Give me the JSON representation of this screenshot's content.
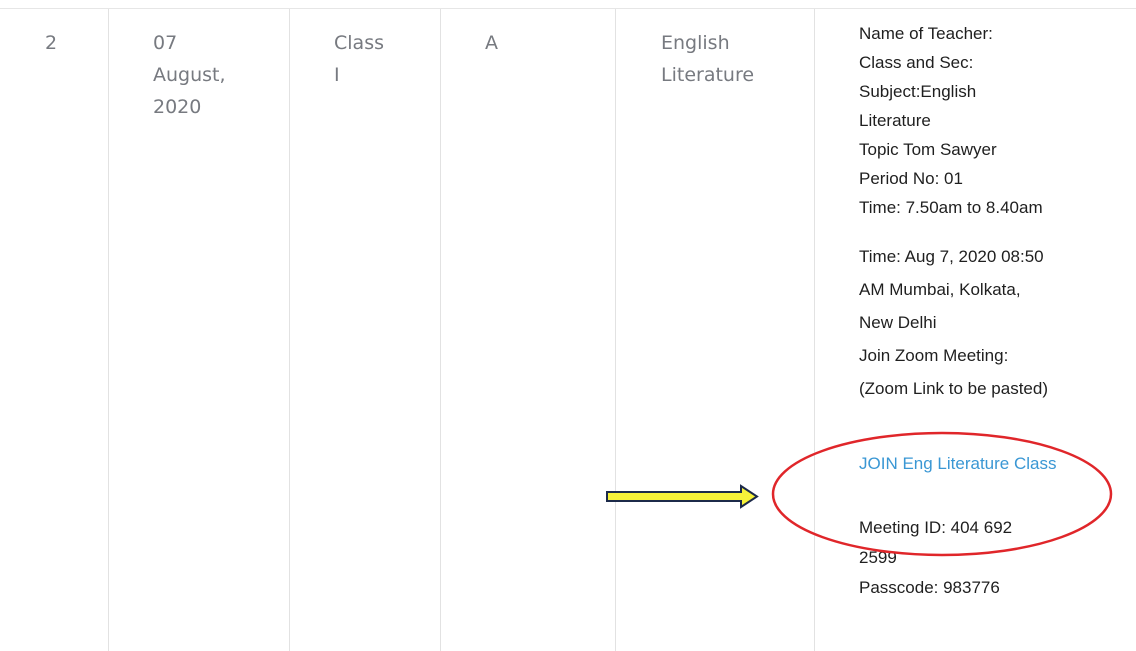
{
  "row": {
    "number": "2",
    "date": "07\nAugust,\n2020",
    "class": "Class\nI",
    "section": "A",
    "subject": "English\nLiterature"
  },
  "details": {
    "block1": [
      "Name  of Teacher:",
      "Class and Sec:",
      "Subject:English",
      "Literature",
      "Topic  Tom Sawyer",
      "Period No: 01",
      "Time:  7.50am to 8.40am"
    ],
    "block2": [
      "Time: Aug 7, 2020 08:50",
      "AM Mumbai, Kolkata,",
      "New Delhi",
      "Join Zoom Meeting:",
      "(Zoom Link to be pasted)"
    ],
    "join_link": "JOIN Eng Literature Class",
    "block3": [
      "Meeting ID: 404 692",
      "2599",
      "Passcode: 983776"
    ]
  },
  "colors": {
    "link": "#3a97d4",
    "arrow_fill": "#f6f23a",
    "arrow_stroke": "#1c2a4a",
    "highlight_ellipse": "#e0262a",
    "grid_line": "#e2e2e2"
  }
}
